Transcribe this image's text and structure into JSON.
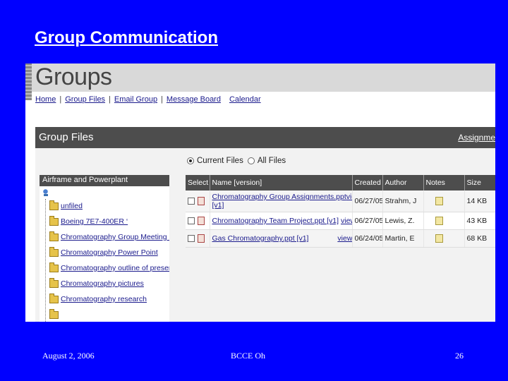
{
  "slide": {
    "title": "Group Communication",
    "footer": {
      "date": "August 2, 2006",
      "center": "BCCE   Oh",
      "page": "26"
    }
  },
  "app": {
    "heading": "Groups",
    "nav": [
      "Home",
      "Group Files",
      "Email Group",
      "Message Board",
      "Calendar"
    ],
    "panel": {
      "title": "Group Files",
      "assign_link": "Assignme",
      "filter": {
        "options": [
          "Current Files",
          "All Files"
        ],
        "selected": "Current Files"
      },
      "tree": {
        "header": "Airframe and Powerplant",
        "items": [
          "unfiled",
          "Boeing 7E7-400ER ‘",
          "Chromatography Group Meeting Notes",
          "Chromatography Power Point",
          "Chromatography outline of presentation",
          "Chromatography pictures",
          "Chromatography research"
        ]
      },
      "files": {
        "columns": [
          "Select",
          "Name [version]",
          "Created",
          "Author",
          "Notes",
          "Size"
        ],
        "rows": [
          {
            "name": "Chromatography Group Assignments.ppt",
            "version": "[v1]",
            "view": "view",
            "created": "06/27/05",
            "author": "Strahm, J",
            "size": "14 KB"
          },
          {
            "name": "Chromatography Team Project.ppt [v1]",
            "version": "",
            "view": "view",
            "created": "06/27/05",
            "author": "Lewis, Z.",
            "size": "43 KB"
          },
          {
            "name": "Gas Chromatography.ppt [v1]",
            "version": "",
            "view": "view",
            "created": "06/24/05",
            "author": "Martin, E",
            "size": "68 KB"
          }
        ]
      }
    }
  }
}
